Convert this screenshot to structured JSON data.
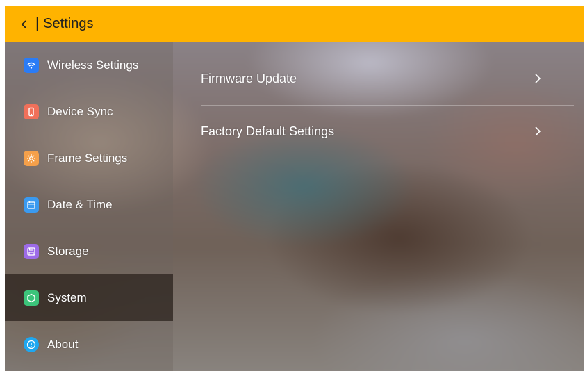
{
  "header": {
    "back_icon": "chevron-left-icon",
    "separator": "|",
    "title": "Settings",
    "color": "#FFB300"
  },
  "sidebar": {
    "items": [
      {
        "label": "Wireless Settings",
        "icon": "wifi-icon",
        "icon_color": "#2A7CF6",
        "selected": false
      },
      {
        "label": "Device Sync",
        "icon": "phone-icon",
        "icon_color": "#F0705A",
        "selected": false
      },
      {
        "label": "Frame Settings",
        "icon": "brightness-icon",
        "icon_color": "#F5A04A",
        "selected": false
      },
      {
        "label": "Date & Time",
        "icon": "calendar-icon",
        "icon_color": "#3A9AF0",
        "selected": false
      },
      {
        "label": "Storage",
        "icon": "save-icon",
        "icon_color": "#9D6BE8",
        "selected": false
      },
      {
        "label": "System",
        "icon": "hexagon-icon",
        "icon_color": "#3CC47A",
        "selected": true
      },
      {
        "label": "About",
        "icon": "info-icon",
        "icon_color": "#1EA7F0",
        "selected": false
      }
    ]
  },
  "main": {
    "rows": [
      {
        "label": "Firmware Update",
        "icon": "chevron-right-icon"
      },
      {
        "label": "Factory Default Settings",
        "icon": "chevron-right-icon"
      }
    ]
  }
}
